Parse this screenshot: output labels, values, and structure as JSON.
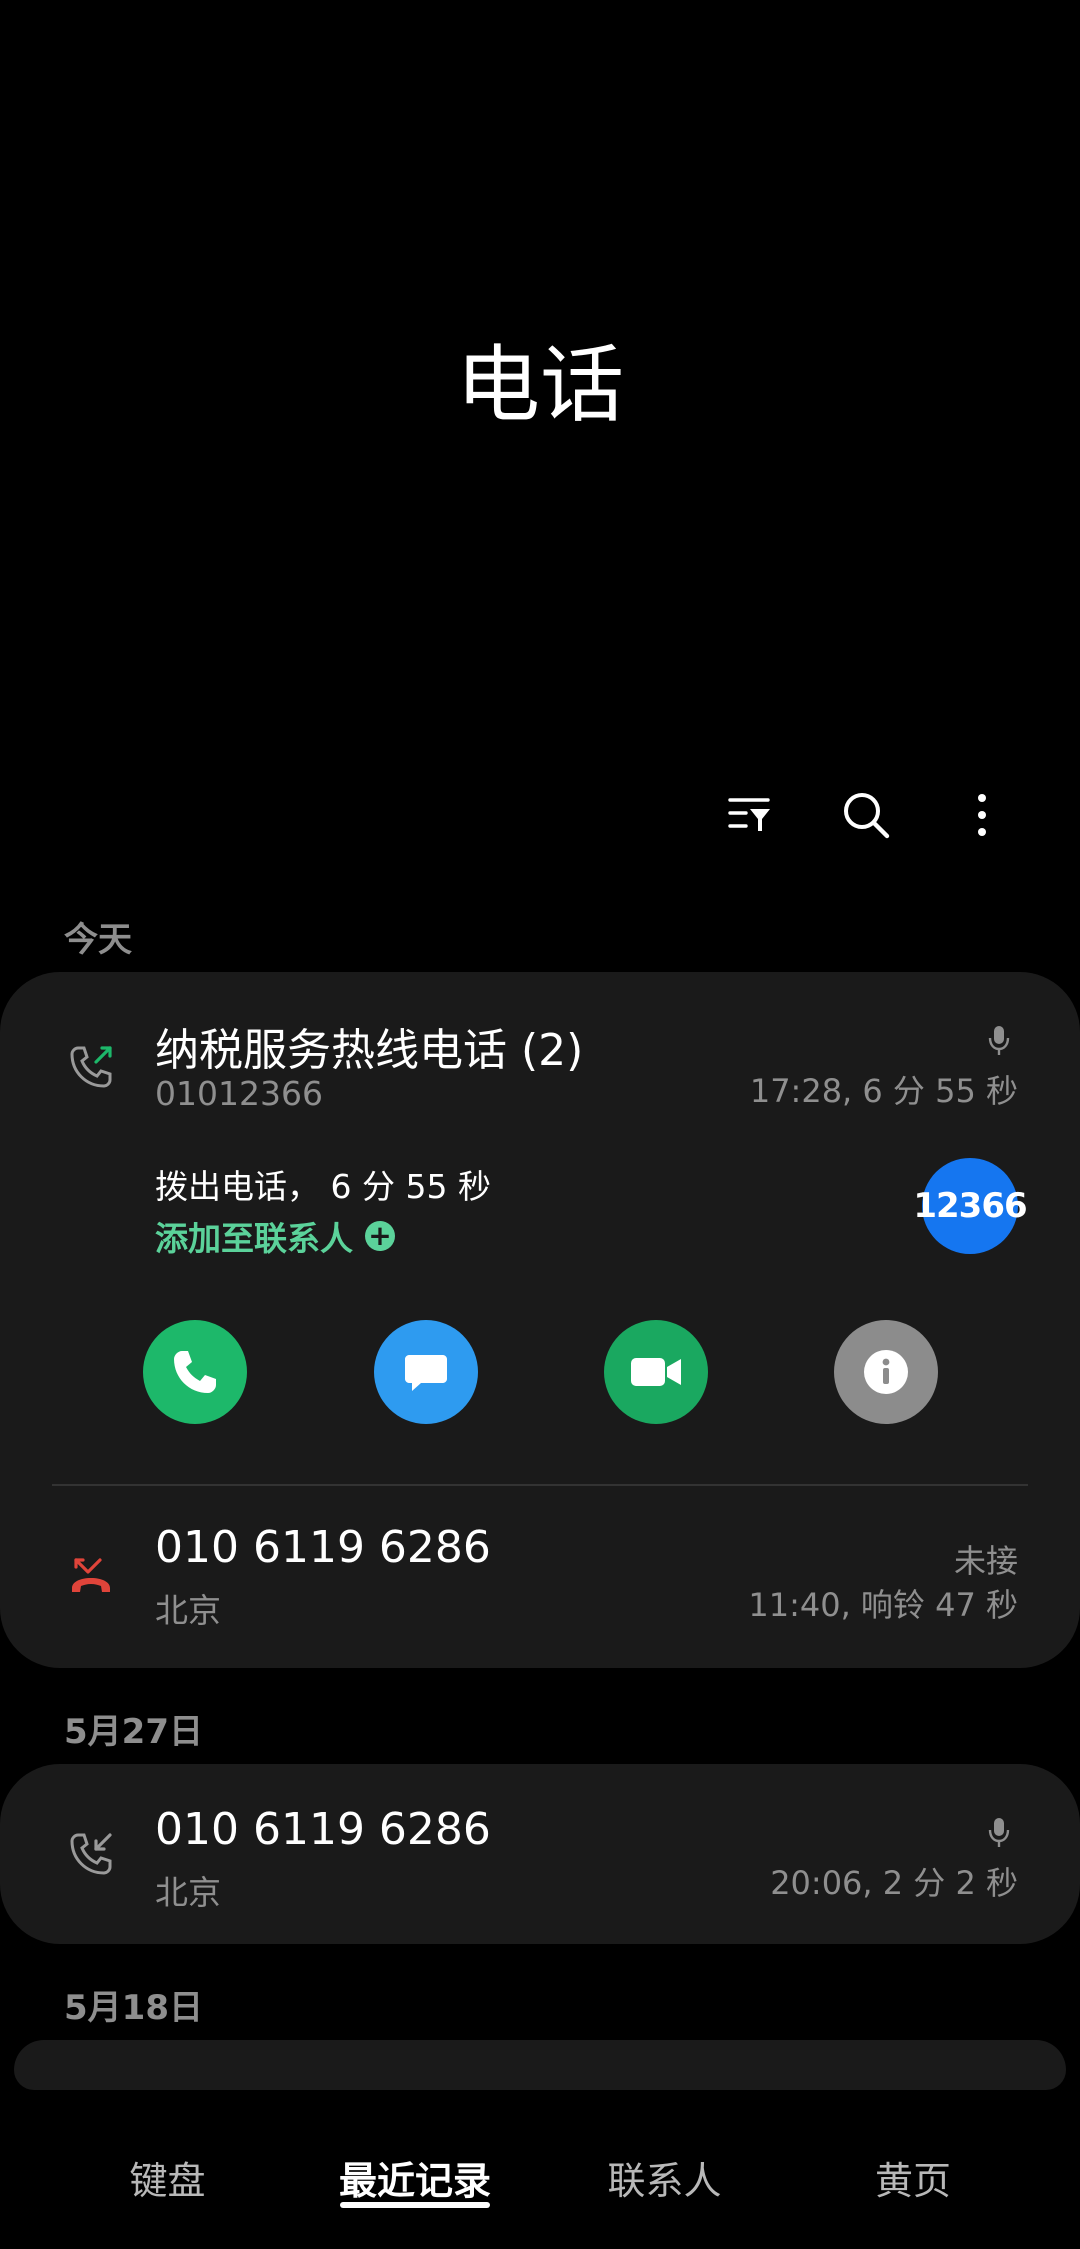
{
  "header": {
    "title": "电话"
  },
  "toolbar": {
    "filter_icon": "filter-icon",
    "search_icon": "search-icon",
    "more_icon": "more-vertical-icon"
  },
  "sections": {
    "today": "今天",
    "may27": "5月27日",
    "may18": "5月18日"
  },
  "expanded_call": {
    "name": "纳税服务热线电话 (2)",
    "number": "01012366",
    "time_duration": "17:28, 6 分 55 秒",
    "detail": "拨出电话， 6 分 55 秒",
    "add_contact": "添加至联系人",
    "avatar_text": "12366",
    "actions": [
      "call",
      "message",
      "video-call",
      "details"
    ]
  },
  "calls": [
    {
      "number": "010 6119 6286",
      "location": "北京",
      "status": "未接",
      "time_duration": "11:40, 响铃 47 秒",
      "type": "missed"
    },
    {
      "number": "010 6119 6286",
      "location": "北京",
      "time_duration": "20:06, 2 分 2 秒",
      "type": "incoming"
    }
  ],
  "bottom_nav": {
    "tabs": [
      "键盘",
      "最近记录",
      "联系人",
      "黄页"
    ],
    "active": "最近记录"
  },
  "colors": {
    "background": "#000000",
    "card": "#1a1a1a",
    "green": "#1db86a",
    "blue": "#2e9bf0",
    "missed_red": "#e0443a",
    "accent_text": "#5bd29a",
    "avatar": "#1576f0"
  }
}
